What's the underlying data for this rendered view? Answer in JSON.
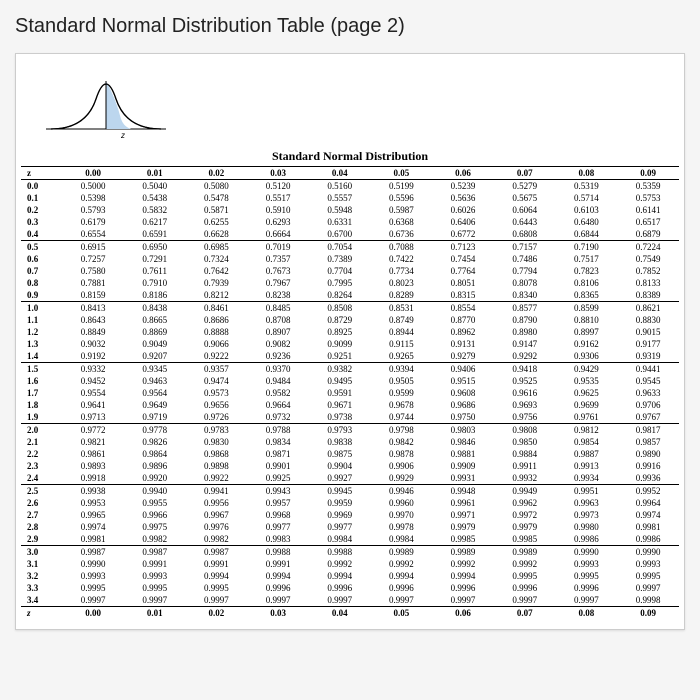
{
  "title": "Standard Normal Distribution Table (page 2)",
  "table_title": "Standard Normal Distribution",
  "z_label": "z",
  "col_headers": [
    "0.00",
    "0.01",
    "0.02",
    "0.03",
    "0.04",
    "0.05",
    "0.06",
    "0.07",
    "0.08",
    "0.09"
  ],
  "groups": [
    [
      {
        "z": "0.0",
        "v": [
          "0.5000",
          "0.5040",
          "0.5080",
          "0.5120",
          "0.5160",
          "0.5199",
          "0.5239",
          "0.5279",
          "0.5319",
          "0.5359"
        ]
      },
      {
        "z": "0.1",
        "v": [
          "0.5398",
          "0.5438",
          "0.5478",
          "0.5517",
          "0.5557",
          "0.5596",
          "0.5636",
          "0.5675",
          "0.5714",
          "0.5753"
        ]
      },
      {
        "z": "0.2",
        "v": [
          "0.5793",
          "0.5832",
          "0.5871",
          "0.5910",
          "0.5948",
          "0.5987",
          "0.6026",
          "0.6064",
          "0.6103",
          "0.6141"
        ]
      },
      {
        "z": "0.3",
        "v": [
          "0.6179",
          "0.6217",
          "0.6255",
          "0.6293",
          "0.6331",
          "0.6368",
          "0.6406",
          "0.6443",
          "0.6480",
          "0.6517"
        ]
      },
      {
        "z": "0.4",
        "v": [
          "0.6554",
          "0.6591",
          "0.6628",
          "0.6664",
          "0.6700",
          "0.6736",
          "0.6772",
          "0.6808",
          "0.6844",
          "0.6879"
        ]
      }
    ],
    [
      {
        "z": "0.5",
        "v": [
          "0.6915",
          "0.6950",
          "0.6985",
          "0.7019",
          "0.7054",
          "0.7088",
          "0.7123",
          "0.7157",
          "0.7190",
          "0.7224"
        ]
      },
      {
        "z": "0.6",
        "v": [
          "0.7257",
          "0.7291",
          "0.7324",
          "0.7357",
          "0.7389",
          "0.7422",
          "0.7454",
          "0.7486",
          "0.7517",
          "0.7549"
        ]
      },
      {
        "z": "0.7",
        "v": [
          "0.7580",
          "0.7611",
          "0.7642",
          "0.7673",
          "0.7704",
          "0.7734",
          "0.7764",
          "0.7794",
          "0.7823",
          "0.7852"
        ]
      },
      {
        "z": "0.8",
        "v": [
          "0.7881",
          "0.7910",
          "0.7939",
          "0.7967",
          "0.7995",
          "0.8023",
          "0.8051",
          "0.8078",
          "0.8106",
          "0.8133"
        ]
      },
      {
        "z": "0.9",
        "v": [
          "0.8159",
          "0.8186",
          "0.8212",
          "0.8238",
          "0.8264",
          "0.8289",
          "0.8315",
          "0.8340",
          "0.8365",
          "0.8389"
        ]
      }
    ],
    [
      {
        "z": "1.0",
        "v": [
          "0.8413",
          "0.8438",
          "0.8461",
          "0.8485",
          "0.8508",
          "0.8531",
          "0.8554",
          "0.8577",
          "0.8599",
          "0.8621"
        ]
      },
      {
        "z": "1.1",
        "v": [
          "0.8643",
          "0.8665",
          "0.8686",
          "0.8708",
          "0.8729",
          "0.8749",
          "0.8770",
          "0.8790",
          "0.8810",
          "0.8830"
        ]
      },
      {
        "z": "1.2",
        "v": [
          "0.8849",
          "0.8869",
          "0.8888",
          "0.8907",
          "0.8925",
          "0.8944",
          "0.8962",
          "0.8980",
          "0.8997",
          "0.9015"
        ]
      },
      {
        "z": "1.3",
        "v": [
          "0.9032",
          "0.9049",
          "0.9066",
          "0.9082",
          "0.9099",
          "0.9115",
          "0.9131",
          "0.9147",
          "0.9162",
          "0.9177"
        ]
      },
      {
        "z": "1.4",
        "v": [
          "0.9192",
          "0.9207",
          "0.9222",
          "0.9236",
          "0.9251",
          "0.9265",
          "0.9279",
          "0.9292",
          "0.9306",
          "0.9319"
        ]
      }
    ],
    [
      {
        "z": "1.5",
        "v": [
          "0.9332",
          "0.9345",
          "0.9357",
          "0.9370",
          "0.9382",
          "0.9394",
          "0.9406",
          "0.9418",
          "0.9429",
          "0.9441"
        ]
      },
      {
        "z": "1.6",
        "v": [
          "0.9452",
          "0.9463",
          "0.9474",
          "0.9484",
          "0.9495",
          "0.9505",
          "0.9515",
          "0.9525",
          "0.9535",
          "0.9545"
        ]
      },
      {
        "z": "1.7",
        "v": [
          "0.9554",
          "0.9564",
          "0.9573",
          "0.9582",
          "0.9591",
          "0.9599",
          "0.9608",
          "0.9616",
          "0.9625",
          "0.9633"
        ]
      },
      {
        "z": "1.8",
        "v": [
          "0.9641",
          "0.9649",
          "0.9656",
          "0.9664",
          "0.9671",
          "0.9678",
          "0.9686",
          "0.9693",
          "0.9699",
          "0.9706"
        ]
      },
      {
        "z": "1.9",
        "v": [
          "0.9713",
          "0.9719",
          "0.9726",
          "0.9732",
          "0.9738",
          "0.9744",
          "0.9750",
          "0.9756",
          "0.9761",
          "0.9767"
        ]
      }
    ],
    [
      {
        "z": "2.0",
        "v": [
          "0.9772",
          "0.9778",
          "0.9783",
          "0.9788",
          "0.9793",
          "0.9798",
          "0.9803",
          "0.9808",
          "0.9812",
          "0.9817"
        ]
      },
      {
        "z": "2.1",
        "v": [
          "0.9821",
          "0.9826",
          "0.9830",
          "0.9834",
          "0.9838",
          "0.9842",
          "0.9846",
          "0.9850",
          "0.9854",
          "0.9857"
        ]
      },
      {
        "z": "2.2",
        "v": [
          "0.9861",
          "0.9864",
          "0.9868",
          "0.9871",
          "0.9875",
          "0.9878",
          "0.9881",
          "0.9884",
          "0.9887",
          "0.9890"
        ]
      },
      {
        "z": "2.3",
        "v": [
          "0.9893",
          "0.9896",
          "0.9898",
          "0.9901",
          "0.9904",
          "0.9906",
          "0.9909",
          "0.9911",
          "0.9913",
          "0.9916"
        ]
      },
      {
        "z": "2.4",
        "v": [
          "0.9918",
          "0.9920",
          "0.9922",
          "0.9925",
          "0.9927",
          "0.9929",
          "0.9931",
          "0.9932",
          "0.9934",
          "0.9936"
        ]
      }
    ],
    [
      {
        "z": "2.5",
        "v": [
          "0.9938",
          "0.9940",
          "0.9941",
          "0.9943",
          "0.9945",
          "0.9946",
          "0.9948",
          "0.9949",
          "0.9951",
          "0.9952"
        ]
      },
      {
        "z": "2.6",
        "v": [
          "0.9953",
          "0.9955",
          "0.9956",
          "0.9957",
          "0.9959",
          "0.9960",
          "0.9961",
          "0.9962",
          "0.9963",
          "0.9964"
        ]
      },
      {
        "z": "2.7",
        "v": [
          "0.9965",
          "0.9966",
          "0.9967",
          "0.9968",
          "0.9969",
          "0.9970",
          "0.9971",
          "0.9972",
          "0.9973",
          "0.9974"
        ]
      },
      {
        "z": "2.8",
        "v": [
          "0.9974",
          "0.9975",
          "0.9976",
          "0.9977",
          "0.9977",
          "0.9978",
          "0.9979",
          "0.9979",
          "0.9980",
          "0.9981"
        ]
      },
      {
        "z": "2.9",
        "v": [
          "0.9981",
          "0.9982",
          "0.9982",
          "0.9983",
          "0.9984",
          "0.9984",
          "0.9985",
          "0.9985",
          "0.9986",
          "0.9986"
        ]
      }
    ],
    [
      {
        "z": "3.0",
        "v": [
          "0.9987",
          "0.9987",
          "0.9987",
          "0.9988",
          "0.9988",
          "0.9989",
          "0.9989",
          "0.9989",
          "0.9990",
          "0.9990"
        ]
      },
      {
        "z": "3.1",
        "v": [
          "0.9990",
          "0.9991",
          "0.9991",
          "0.9991",
          "0.9992",
          "0.9992",
          "0.9992",
          "0.9992",
          "0.9993",
          "0.9993"
        ]
      },
      {
        "z": "3.2",
        "v": [
          "0.9993",
          "0.9993",
          "0.9994",
          "0.9994",
          "0.9994",
          "0.9994",
          "0.9994",
          "0.9995",
          "0.9995",
          "0.9995"
        ]
      },
      {
        "z": "3.3",
        "v": [
          "0.9995",
          "0.9995",
          "0.9995",
          "0.9996",
          "0.9996",
          "0.9996",
          "0.9996",
          "0.9996",
          "0.9996",
          "0.9997"
        ]
      },
      {
        "z": "3.4",
        "v": [
          "0.9997",
          "0.9997",
          "0.9997",
          "0.9997",
          "0.9997",
          "0.9997",
          "0.9997",
          "0.9997",
          "0.9997",
          "0.9998"
        ]
      }
    ]
  ]
}
